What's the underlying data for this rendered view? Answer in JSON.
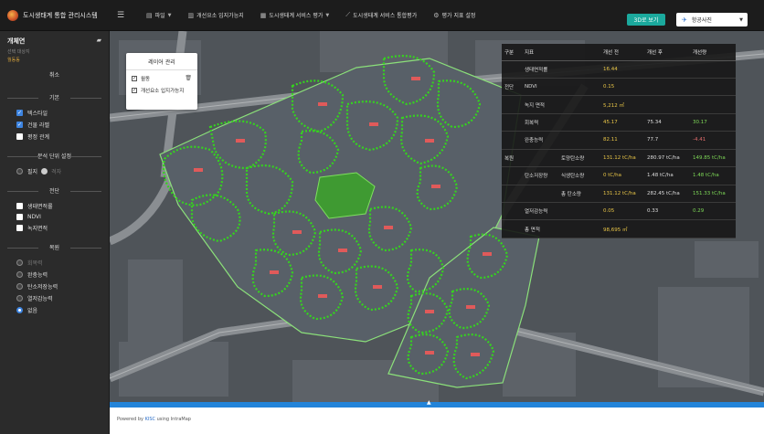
{
  "app": {
    "title": "도시생태계 통합 관리시스템"
  },
  "topbar": {
    "menu_icon": "hamburger-icon",
    "menus": [
      {
        "label": "파일",
        "icon": "file-icon",
        "dropdown": true
      },
      {
        "label": "개선요소 입지가능지",
        "icon": "map-icon",
        "dropdown": false
      },
      {
        "label": "도시생태계 서비스 평가",
        "icon": "chart-icon",
        "dropdown": true
      },
      {
        "label": "도시생태계 서비스 통합평가",
        "icon": "trend-icon",
        "dropdown": false
      },
      {
        "label": "평가 지표 설정",
        "icon": "gear-icon",
        "dropdown": false
      }
    ],
    "view_button": "3D로 보기",
    "basemap": {
      "selected": "항공사진",
      "icon": "plane-icon"
    }
  },
  "sidebar": {
    "title": "개체연",
    "subtitle": "선택 대상지",
    "highlight": "월동동",
    "delete_label": "취소",
    "section_basic": "기본",
    "basic_items": [
      {
        "label": "텍스타일",
        "checked": true
      },
      {
        "label": "건물 라벨",
        "checked": true
      },
      {
        "label": "평정 관계",
        "checked": false
      }
    ],
    "section_unit": "분석 단위 설정",
    "unit_options": {
      "left": "필지",
      "right": "격자"
    },
    "section_before": "전단",
    "before_items": [
      {
        "label": "생태면적률",
        "checked": false
      },
      {
        "label": "NDVI",
        "checked": false
      },
      {
        "label": "녹지면적",
        "checked": false
      }
    ],
    "section_restore": "복원",
    "restore_items": [
      {
        "label": "회복력",
        "on": false,
        "dim": true
      },
      {
        "label": "완충능력",
        "on": false,
        "dim": false
      },
      {
        "label": "탄소저장능력",
        "on": false,
        "dim": false
      },
      {
        "label": "열저감능력",
        "on": false,
        "dim": false
      },
      {
        "label": "없음",
        "on": true,
        "dim": false
      }
    ]
  },
  "layer_panel": {
    "title": "레이어 관리",
    "items": [
      {
        "label": "월동",
        "checked": true,
        "trash": true
      },
      {
        "label": "개선요소 입지가능지",
        "checked": true,
        "trash": false
      }
    ]
  },
  "data_table": {
    "headers": [
      "구분",
      "지표",
      "개선 전",
      "개선 후",
      "개선량"
    ],
    "rows": [
      {
        "group": "전단",
        "indicator": "생태면적률",
        "sub": "",
        "before": "16.44",
        "after": "",
        "delta": ""
      },
      {
        "group": "",
        "indicator": "NDVI",
        "sub": "",
        "before": "0.15",
        "after": "",
        "delta": ""
      },
      {
        "group": "",
        "indicator": "녹지 면적",
        "sub": "",
        "before": "5,212 ㎡",
        "after": "",
        "delta": ""
      },
      {
        "group": "",
        "indicator": "회복력",
        "sub": "",
        "before": "45.17",
        "after": "75.34",
        "delta": "30.17"
      },
      {
        "group": "복원",
        "indicator": "완충능력",
        "sub": "",
        "before": "82.11",
        "after": "77.7",
        "delta": "-4.41"
      },
      {
        "group": "",
        "indicator": "탄소저장량",
        "sub": "토양탄소량",
        "before": "131.12 tC/ha",
        "after": "280.97 tC/ha",
        "delta": "149.85 tC/ha"
      },
      {
        "group": "",
        "indicator": "",
        "sub": "식생탄소량",
        "before": "0 tC/ha",
        "after": "1.48 tC/ha",
        "delta": "1.48 tC/ha"
      },
      {
        "group": "",
        "indicator": "",
        "sub": "총 탄소량",
        "before": "131.12 tC/ha",
        "after": "282.45 tC/ha",
        "delta": "151.33 tC/ha"
      },
      {
        "group": "",
        "indicator": "열저감능력",
        "sub": "",
        "before": "0.05",
        "after": "0.33",
        "delta": "0.29"
      },
      {
        "group": "",
        "indicator": "총 면적",
        "sub": "",
        "before": "98,695 ㎡",
        "after": "",
        "delta": ""
      }
    ]
  },
  "footer": {
    "powered_prefix": "Powered by ",
    "brand": "KISC",
    "powered_suffix": " using IntraMap"
  },
  "colors": {
    "accent": "#1ba99d",
    "highlight": "#e8c547",
    "positive": "#7ed957",
    "negative": "#e06c6c",
    "green_zone": "#35d41e"
  }
}
